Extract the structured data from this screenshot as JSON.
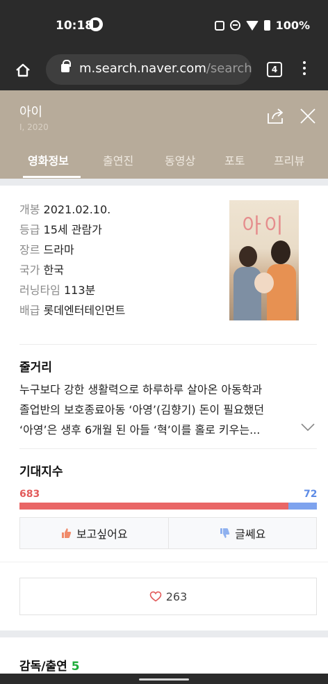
{
  "status_bar": {
    "time": "10:18",
    "battery": "100%"
  },
  "browser": {
    "url_host": "m.search.naver.com",
    "url_path": "/search",
    "tab_count": "4"
  },
  "movie": {
    "title": "아이",
    "subtitle": "I, 2020"
  },
  "tabs": [
    {
      "label": "영화정보"
    },
    {
      "label": "출연진"
    },
    {
      "label": "동영상"
    },
    {
      "label": "포토"
    },
    {
      "label": "프리뷰"
    }
  ],
  "info": [
    {
      "label": "개봉",
      "value": "2021.02.10."
    },
    {
      "label": "등급",
      "value": "15세 관람가"
    },
    {
      "label": "장르",
      "value": "드라마"
    },
    {
      "label": "국가",
      "value": "한국"
    },
    {
      "label": "러닝타임",
      "value": "113분"
    },
    {
      "label": "배급",
      "value": "롯데엔터테인먼트"
    }
  ],
  "poster": {
    "title": "아이"
  },
  "synopsis": {
    "title": "줄거리",
    "lines": [
      "누구보다 강한 생활력으로 하루하루 살아온 아동학과",
      "졸업반의 보호종료아동 ‘아영’(김향기) 돈이 필요했던",
      "‘아영’은 생후 6개월 된 아들 ‘혁’이를 홀로 키우는..."
    ]
  },
  "expectation": {
    "title": "기대지수",
    "want": 683,
    "not_sure": 72,
    "want_label": "보고싶어요",
    "not_sure_label": "글쎄요",
    "want_color": "#e96666",
    "not_sure_color": "#7ea3ee"
  },
  "likes": {
    "count": "263"
  },
  "cast": {
    "title": "감독/출연",
    "count": "5"
  }
}
